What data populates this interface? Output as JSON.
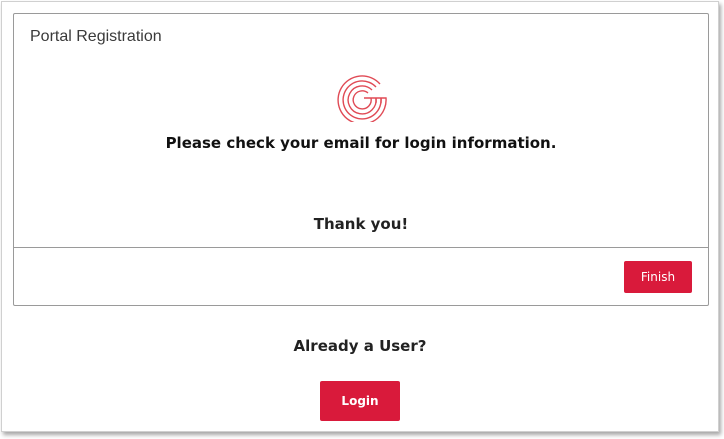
{
  "card": {
    "title": "Portal Registration",
    "logo_icon": "g-brand-logo-icon",
    "message": "Please check your email for login information.",
    "thanks": "Thank you!",
    "finish_label": "Finish"
  },
  "footer": {
    "prompt": "Already a User?",
    "login_label": "Login"
  },
  "colors": {
    "accent": "#d91a3b",
    "logo": "#e04a55",
    "border": "#9a9a9a"
  }
}
